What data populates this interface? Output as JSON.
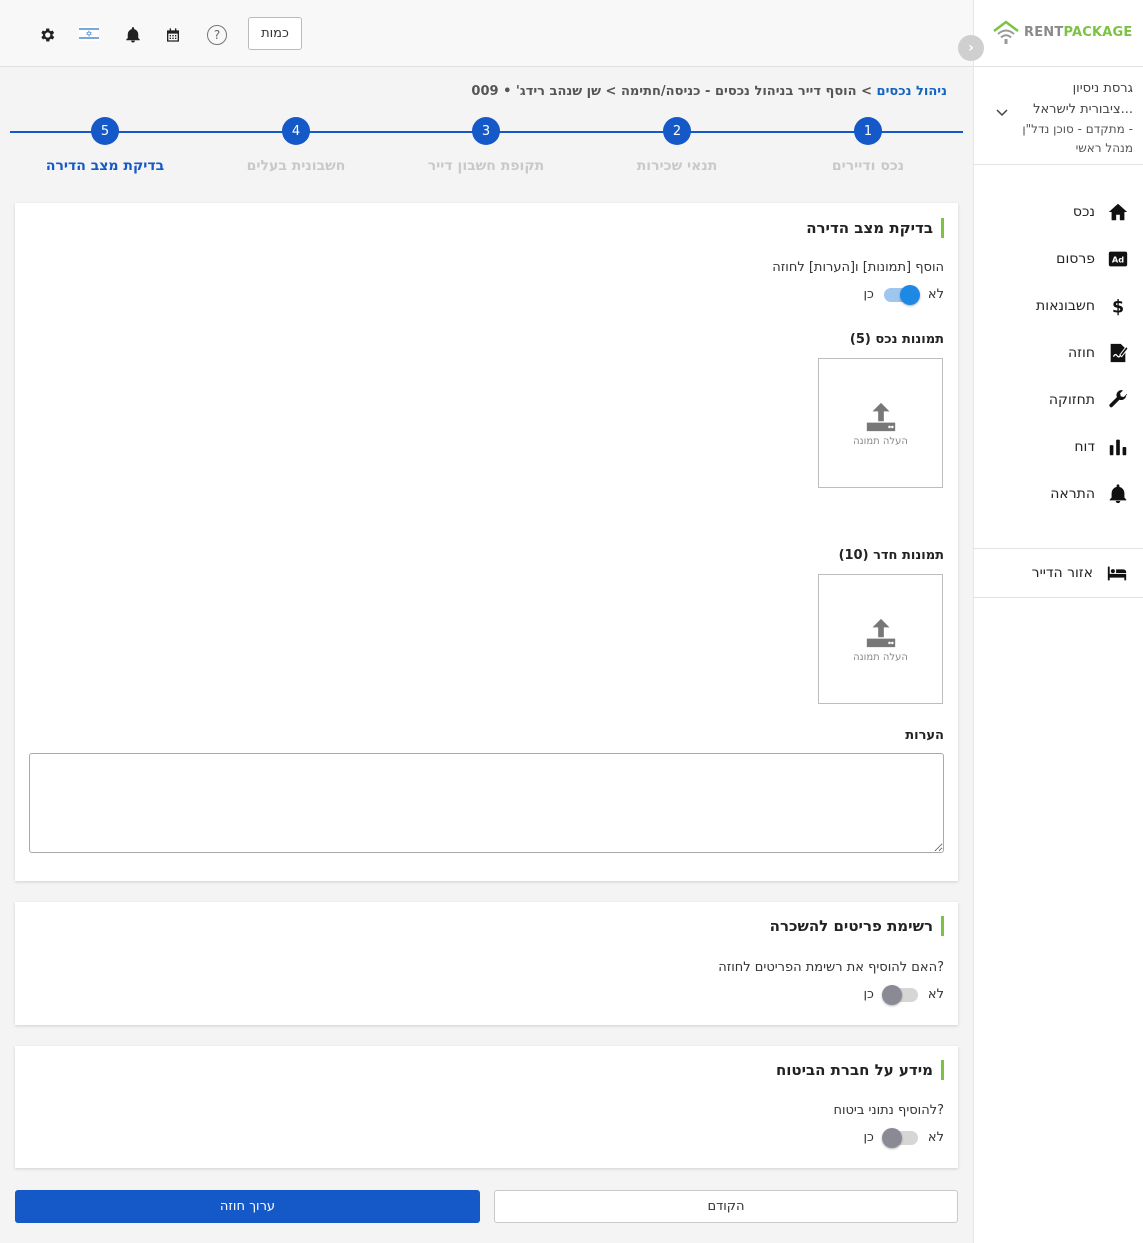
{
  "header": {
    "button_label": "כמות",
    "help_glyph": "?",
    "icons": [
      "gear-icon",
      "israel-flag-icon",
      "bell-icon",
      "calendar-icon",
      "help-icon"
    ]
  },
  "sidebar": {
    "logo": {
      "part1": "RENT",
      "part2": "PACKAGE"
    },
    "collapse_glyph": "›",
    "version": {
      "line1": "גרסת ניסיון",
      "line2": "ציבורית לישראל...",
      "line3": "מתקדם - סוכן נדל\"ן -",
      "line4": "מנהל ראשי"
    },
    "items": [
      {
        "label": "נכס",
        "icon": "home-icon"
      },
      {
        "label": "פרסום",
        "icon": "ad-icon"
      },
      {
        "label": "חשבונאות",
        "icon": "dollar-icon"
      },
      {
        "label": "חוזה",
        "icon": "contract-icon"
      },
      {
        "label": "תחזוקה",
        "icon": "wrench-icon"
      },
      {
        "label": "דוח",
        "icon": "bar-chart-icon"
      },
      {
        "label": "התראה",
        "icon": "bell-icon"
      }
    ],
    "tenant_area": {
      "label": "אזור הדייר",
      "icon": "bed-icon"
    }
  },
  "breadcrumb": {
    "link": "ניהול נכסים",
    "sep": " > ",
    "middle": "הוסף דייר בניהול נכסים - כניסה/חתימה",
    "sep2": " > ",
    "current": "שן שנהב רידג' • 009"
  },
  "stepper": [
    {
      "num": "1",
      "label": "נכס ודיירים",
      "active": false
    },
    {
      "num": "2",
      "label": "תנאי שכירות",
      "active": false
    },
    {
      "num": "3",
      "label": "תקופת חשבון דייר",
      "active": false
    },
    {
      "num": "4",
      "label": "חשבונית בעלים",
      "active": false
    },
    {
      "num": "5",
      "label": "בדיקת מצב הדירה",
      "active": true
    }
  ],
  "inspection": {
    "title": "בדיקת מצב הדירה",
    "question": "הוסף [תמונות] ו[הערות] לחוזה",
    "toggle": {
      "no": "לא",
      "yes": "כן",
      "on": true
    },
    "property_photos_label": "תמונות נכס (5)",
    "room_photos_label": "תמונות חדר (10)",
    "upload_text": "העלה תמונה",
    "notes_label": "הערות",
    "notes_value": ""
  },
  "items_list": {
    "title": "רשימת פריטים להשכרה",
    "question": "האם להוסיף את רשימת הפריטים לחוזה?",
    "toggle": {
      "no": "לא",
      "yes": "כן",
      "on": false
    }
  },
  "insurance": {
    "title": "מידע על חברת הביטוח",
    "question": "להוסיף נתוני ביטוח?",
    "toggle": {
      "no": "לא",
      "yes": "כן",
      "on": false
    }
  },
  "footer": {
    "prev_label": "הקודם",
    "edit_label": "ערוך חוזה"
  },
  "colors": {
    "primary": "#1558c8",
    "accent_green": "#7cc243",
    "toggle_on": "#1e88e5"
  }
}
